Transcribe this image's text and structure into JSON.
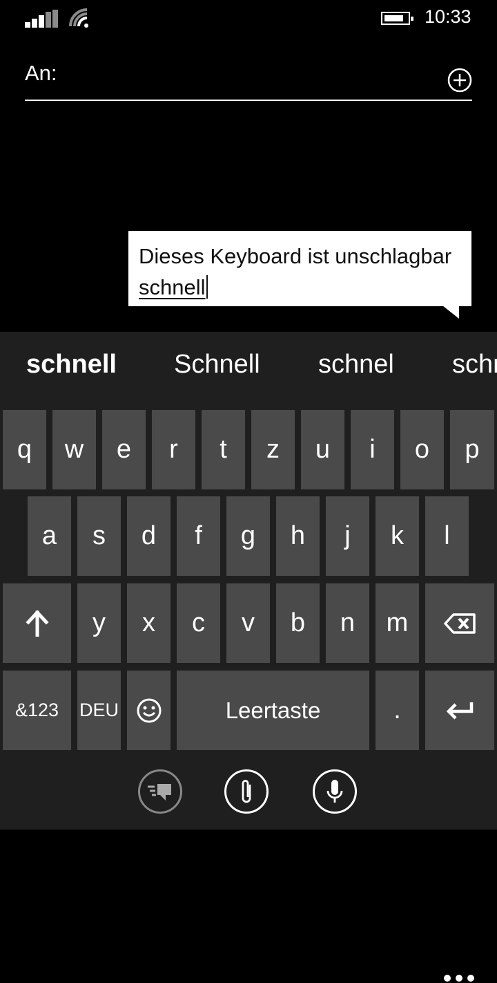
{
  "status_bar": {
    "time": "10:33",
    "signal_icon": "signal-bars-icon",
    "wifi_icon": "wifi-icon",
    "battery_icon": "battery-icon"
  },
  "compose": {
    "to_label": "An:",
    "add_icon": "plus-circle-icon",
    "message_prefix": "Dieses Keyboard ist unschlagbar ",
    "message_current_word": "schnell"
  },
  "keyboard": {
    "suggestions": [
      "schnell",
      "Schnell",
      "schnel",
      "schne"
    ],
    "row1": [
      "q",
      "w",
      "e",
      "r",
      "t",
      "z",
      "u",
      "i",
      "o",
      "p"
    ],
    "row2": [
      "a",
      "s",
      "d",
      "f",
      "g",
      "h",
      "j",
      "k",
      "l"
    ],
    "row3": [
      "y",
      "x",
      "c",
      "v",
      "b",
      "n",
      "m"
    ],
    "shift_icon": "shift-arrow-up-icon",
    "backspace_icon": "backspace-icon",
    "numbers_label": "&123",
    "language_label": "DEU",
    "emoji_icon": "smiley-icon",
    "space_label": "Leertaste",
    "period_label": ".",
    "enter_icon": "enter-icon"
  },
  "app_bar": {
    "buttons": [
      "quick-replies-icon",
      "attach-paperclip-icon",
      "microphone-icon"
    ],
    "more_icon": "ellipsis-icon"
  }
}
